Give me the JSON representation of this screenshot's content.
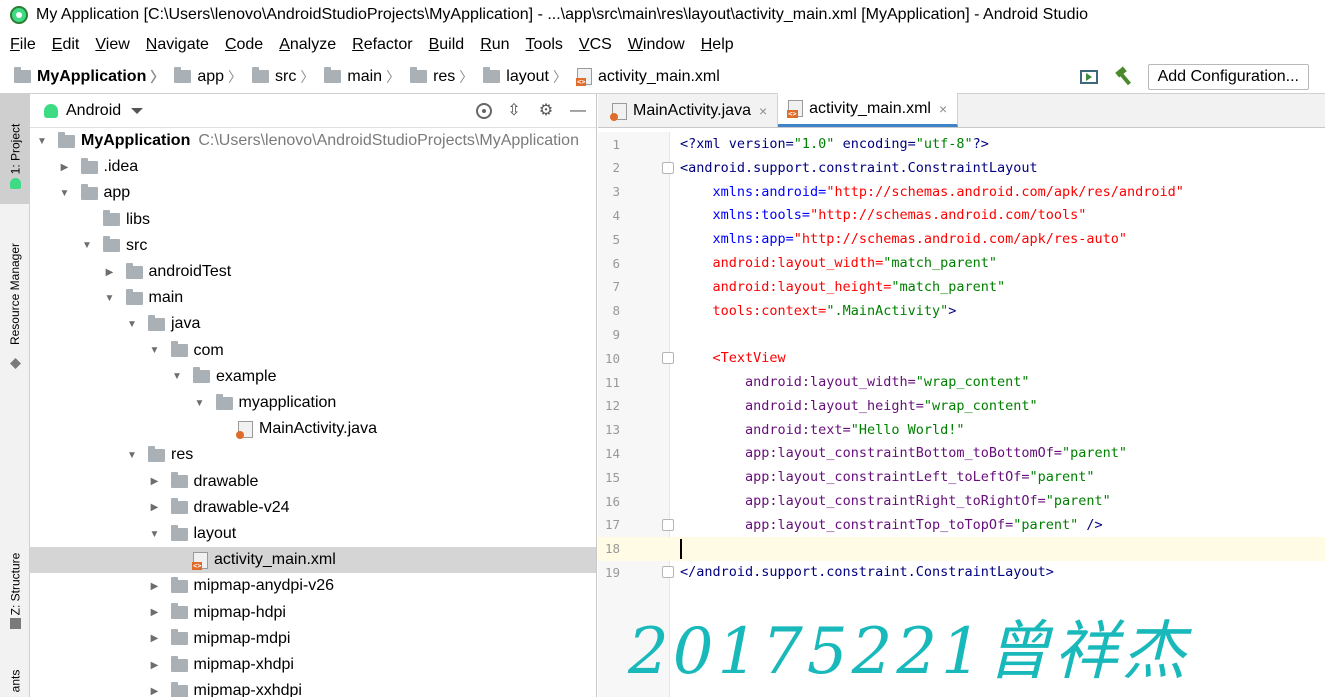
{
  "window": {
    "title": "My Application [C:\\Users\\lenovo\\AndroidStudioProjects\\MyApplication] - ...\\app\\src\\main\\res\\layout\\activity_main.xml [MyApplication] - Android Studio"
  },
  "menu": [
    {
      "label": "File"
    },
    {
      "label": "Edit"
    },
    {
      "label": "View"
    },
    {
      "label": "Navigate"
    },
    {
      "label": "Code"
    },
    {
      "label": "Analyze"
    },
    {
      "label": "Refactor"
    },
    {
      "label": "Build"
    },
    {
      "label": "Run"
    },
    {
      "label": "Tools"
    },
    {
      "label": "VCS"
    },
    {
      "label": "Window"
    },
    {
      "label": "Help"
    }
  ],
  "breadcrumb": [
    {
      "label": "MyApplication",
      "icon": "folder-icon"
    },
    {
      "label": "app",
      "icon": "folder-icon"
    },
    {
      "label": "src",
      "icon": "folder-icon"
    },
    {
      "label": "main",
      "icon": "folder-icon"
    },
    {
      "label": "res",
      "icon": "folder-icon"
    },
    {
      "label": "layout",
      "icon": "folder-icon"
    },
    {
      "label": "activity_main.xml",
      "icon": "xml-file-icon"
    }
  ],
  "toolbar": {
    "add_configuration": "Add Configuration..."
  },
  "left_stripe": {
    "project": "1: Project",
    "resource_manager": "Resource Manager",
    "structure": "Z: Structure",
    "variants": "ants"
  },
  "project_panel": {
    "view": "Android",
    "tree": [
      {
        "label": "MyApplication",
        "path": "C:\\Users\\lenovo\\AndroidStudioProjects\\MyApplication",
        "depth": 0,
        "expanded": true,
        "icon": "folder-icon",
        "bold": true
      },
      {
        "label": ".idea",
        "depth": 1,
        "expanded": false,
        "icon": "folder-icon"
      },
      {
        "label": "app",
        "depth": 1,
        "expanded": true,
        "icon": "folder-icon"
      },
      {
        "label": "libs",
        "depth": 2,
        "leaf": true,
        "icon": "folder-icon"
      },
      {
        "label": "src",
        "depth": 2,
        "expanded": true,
        "icon": "folder-icon"
      },
      {
        "label": "androidTest",
        "depth": 3,
        "expanded": false,
        "icon": "folder-icon"
      },
      {
        "label": "main",
        "depth": 3,
        "expanded": true,
        "icon": "folder-icon"
      },
      {
        "label": "java",
        "depth": 4,
        "expanded": true,
        "icon": "folder-icon"
      },
      {
        "label": "com",
        "depth": 5,
        "expanded": true,
        "icon": "folder-icon"
      },
      {
        "label": "example",
        "depth": 6,
        "expanded": true,
        "icon": "folder-icon"
      },
      {
        "label": "myapplication",
        "depth": 7,
        "expanded": true,
        "icon": "folder-icon"
      },
      {
        "label": "MainActivity.java",
        "depth": 8,
        "leaf": true,
        "icon": "java-file-icon"
      },
      {
        "label": "res",
        "depth": 4,
        "expanded": true,
        "icon": "folder-icon"
      },
      {
        "label": "drawable",
        "depth": 5,
        "expanded": false,
        "icon": "folder-icon"
      },
      {
        "label": "drawable-v24",
        "depth": 5,
        "expanded": false,
        "icon": "folder-icon"
      },
      {
        "label": "layout",
        "depth": 5,
        "expanded": true,
        "icon": "folder-icon"
      },
      {
        "label": "activity_main.xml",
        "depth": 6,
        "leaf": true,
        "icon": "xml-file-icon",
        "selected": true
      },
      {
        "label": "mipmap-anydpi-v26",
        "depth": 5,
        "expanded": false,
        "icon": "folder-icon"
      },
      {
        "label": "mipmap-hdpi",
        "depth": 5,
        "expanded": false,
        "icon": "folder-icon"
      },
      {
        "label": "mipmap-mdpi",
        "depth": 5,
        "expanded": false,
        "icon": "folder-icon"
      },
      {
        "label": "mipmap-xhdpi",
        "depth": 5,
        "expanded": false,
        "icon": "folder-icon"
      },
      {
        "label": "mipmap-xxhdpi",
        "depth": 5,
        "expanded": false,
        "icon": "folder-icon"
      }
    ]
  },
  "editor": {
    "tabs": [
      {
        "label": "MainActivity.java",
        "icon": "java-file-icon",
        "active": false
      },
      {
        "label": "activity_main.xml",
        "icon": "xml-file-icon",
        "active": true
      }
    ],
    "current_line": 18,
    "lines": [
      {
        "n": "1",
        "fold": false,
        "parts": [
          [
            "tk-decl",
            "<?xml version="
          ],
          [
            "str",
            "\"1.0\""
          ],
          [
            "tk-decl",
            " encoding="
          ],
          [
            "str",
            "\"utf-8\""
          ],
          [
            "tk-decl",
            "?>"
          ]
        ]
      },
      {
        "n": "2",
        "fold": true,
        "parts": [
          [
            "tk-tag",
            "<android.support.constraint.ConstraintLayout"
          ]
        ]
      },
      {
        "n": "3",
        "fold": false,
        "parts": [
          [
            "tk-punct",
            "    "
          ],
          [
            "attr-blue",
            "xmlns:android="
          ],
          [
            "url",
            "\"http://schemas.android.com/apk/res/android\""
          ]
        ]
      },
      {
        "n": "4",
        "fold": false,
        "parts": [
          [
            "tk-punct",
            "    "
          ],
          [
            "attr-blue",
            "xmlns:tools="
          ],
          [
            "url",
            "\"http://schemas.android.com/tools\""
          ]
        ]
      },
      {
        "n": "5",
        "fold": false,
        "parts": [
          [
            "tk-punct",
            "    "
          ],
          [
            "attr-blue",
            "xmlns:app="
          ],
          [
            "url",
            "\"http://schemas.android.com/apk/res-auto\""
          ]
        ]
      },
      {
        "n": "6",
        "fold": false,
        "parts": [
          [
            "tk-punct",
            "    "
          ],
          [
            "attr-android",
            "android:layout_width="
          ],
          [
            "str",
            "\"match_parent\""
          ]
        ]
      },
      {
        "n": "7",
        "fold": false,
        "parts": [
          [
            "tk-punct",
            "    "
          ],
          [
            "attr-android",
            "android:layout_height="
          ],
          [
            "str",
            "\"match_parent\""
          ]
        ]
      },
      {
        "n": "8",
        "fold": false,
        "parts": [
          [
            "tk-punct",
            "    "
          ],
          [
            "attr-android",
            "tools:context="
          ],
          [
            "str",
            "\".MainActivity\""
          ],
          [
            "tk-tag",
            ">"
          ]
        ]
      },
      {
        "n": "9",
        "fold": false,
        "parts": []
      },
      {
        "n": "10",
        "fold": true,
        "parts": [
          [
            "tk-punct",
            "    "
          ],
          [
            "attr-android",
            "<TextView"
          ]
        ]
      },
      {
        "n": "11",
        "fold": false,
        "parts": [
          [
            "tk-punct",
            "        "
          ],
          [
            "attr-app",
            "android:layout_width="
          ],
          [
            "str",
            "\"wrap_content\""
          ]
        ]
      },
      {
        "n": "12",
        "fold": false,
        "parts": [
          [
            "tk-punct",
            "        "
          ],
          [
            "attr-app",
            "android:layout_height="
          ],
          [
            "str",
            "\"wrap_content\""
          ]
        ]
      },
      {
        "n": "13",
        "fold": false,
        "parts": [
          [
            "tk-punct",
            "        "
          ],
          [
            "attr-app",
            "android:text="
          ],
          [
            "str",
            "\"Hello World!\""
          ]
        ]
      },
      {
        "n": "14",
        "fold": false,
        "parts": [
          [
            "tk-punct",
            "        "
          ],
          [
            "attr-app",
            "app:layout_constraintBottom_toBottomOf="
          ],
          [
            "str",
            "\"parent\""
          ]
        ]
      },
      {
        "n": "15",
        "fold": false,
        "parts": [
          [
            "tk-punct",
            "        "
          ],
          [
            "attr-app",
            "app:layout_constraintLeft_toLeftOf="
          ],
          [
            "str",
            "\"parent\""
          ]
        ]
      },
      {
        "n": "16",
        "fold": false,
        "parts": [
          [
            "tk-punct",
            "        "
          ],
          [
            "attr-app",
            "app:layout_constraintRight_toRightOf="
          ],
          [
            "str",
            "\"parent\""
          ]
        ]
      },
      {
        "n": "17",
        "fold": true,
        "parts": [
          [
            "tk-punct",
            "        "
          ],
          [
            "attr-app",
            "app:layout_constraintTop_toTopOf="
          ],
          [
            "str",
            "\"parent\""
          ],
          [
            "tk-tag",
            " />"
          ]
        ]
      },
      {
        "n": "18",
        "fold": false,
        "parts": []
      },
      {
        "n": "19",
        "fold": true,
        "parts": [
          [
            "tk-tag",
            "</android.support.constraint.ConstraintLayout>"
          ]
        ]
      }
    ]
  },
  "watermark": "20175221曾祥杰"
}
